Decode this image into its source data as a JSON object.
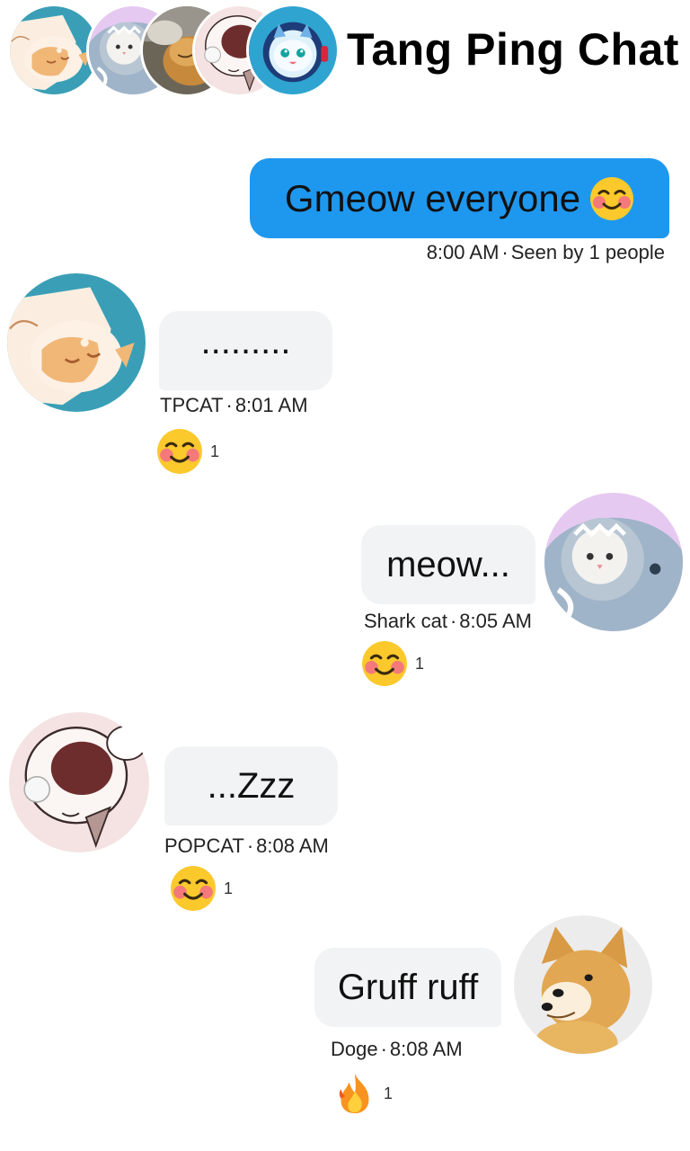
{
  "header": {
    "title": "Tang Ping Chat",
    "avatars": [
      "tpcat-avatar",
      "shark-cat-avatar",
      "photo-cat-avatar",
      "popcat-avatar",
      "astronaut-cat-avatar"
    ]
  },
  "messages": [
    {
      "text": "Gmeow everyone",
      "time": "8:00 AM",
      "seen": "Seen by 1 people"
    },
    {
      "text": ".........",
      "sender": "TPCAT",
      "time": "8:01 AM",
      "reaction_count": "1"
    },
    {
      "text": "meow...",
      "sender": "Shark cat",
      "time": "8:05 AM",
      "reaction_count": "1"
    },
    {
      "text": "...Zzz",
      "sender": "POPCAT",
      "time": "8:08 AM",
      "reaction_count": "1"
    },
    {
      "text": "Gruff ruff",
      "sender": "Doge",
      "time": "8:08 AM",
      "reaction_count": "1"
    }
  ],
  "separator": "·",
  "colors": {
    "sent_bubble": "#1e98ef",
    "received_bubble": "#f1f3f4"
  }
}
